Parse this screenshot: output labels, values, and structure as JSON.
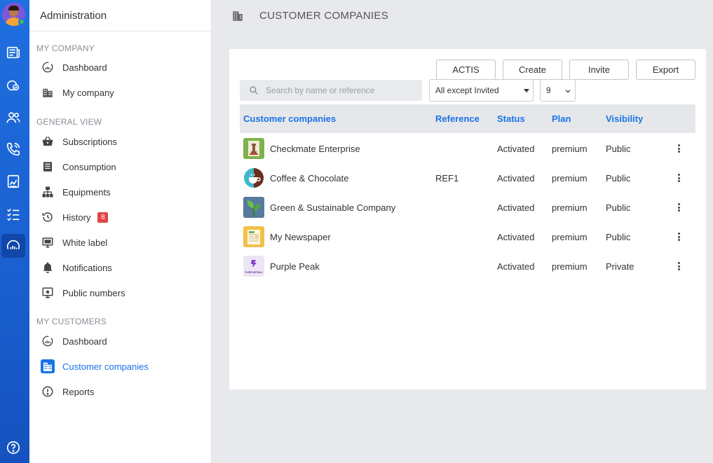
{
  "sidebar": {
    "header": "Administration",
    "sections": [
      {
        "label": "MY COMPANY",
        "items": [
          {
            "label": "Dashboard",
            "icon": "dashboard-icon"
          },
          {
            "label": "My company",
            "icon": "building-icon"
          }
        ]
      },
      {
        "label": "GENERAL VIEW",
        "items": [
          {
            "label": "Subscriptions",
            "icon": "basket-icon"
          },
          {
            "label": "Consumption",
            "icon": "list-icon"
          },
          {
            "label": "Equipments",
            "icon": "hierarchy-icon"
          },
          {
            "label": "History",
            "icon": "history-icon",
            "badge": "8"
          },
          {
            "label": "White label",
            "icon": "monitor-icon"
          },
          {
            "label": "Notifications",
            "icon": "bell-icon"
          },
          {
            "label": "Public numbers",
            "icon": "public-numbers-icon"
          }
        ]
      },
      {
        "label": "MY CUSTOMERS",
        "items": [
          {
            "label": "Dashboard",
            "icon": "dashboard-icon"
          },
          {
            "label": "Customer companies",
            "icon": "building-icon",
            "active": true
          },
          {
            "label": "Reports",
            "icon": "alert-icon"
          }
        ]
      }
    ]
  },
  "header": {
    "title": "CUSTOMER COMPANIES"
  },
  "toolbar": {
    "actis": "ACTIS",
    "create": "Create",
    "invite": "Invite",
    "export": "Export"
  },
  "search": {
    "placeholder": "Search by name or reference",
    "value": ""
  },
  "filters": {
    "status_filter": "All except Invited",
    "page_size": "9"
  },
  "table": {
    "columns": [
      "Customer companies",
      "Reference",
      "Status",
      "Plan",
      "Visibility"
    ],
    "rows": [
      {
        "name": "Checkmate Enterprise",
        "reference": "",
        "status": "Activated",
        "plan": "premium",
        "visibility": "Public",
        "logo": "chess-logo"
      },
      {
        "name": "Coffee & Chocolate",
        "reference": "REF1",
        "status": "Activated",
        "plan": "premium",
        "visibility": "Public",
        "logo": "coffee-logo"
      },
      {
        "name": "Green & Sustainable Company",
        "reference": "",
        "status": "Activated",
        "plan": "premium",
        "visibility": "Public",
        "logo": "leaf-logo"
      },
      {
        "name": "My Newspaper",
        "reference": "",
        "status": "Activated",
        "plan": "premium",
        "visibility": "Public",
        "logo": "newspaper-logo"
      },
      {
        "name": "Purple Peak",
        "reference": "",
        "status": "Activated",
        "plan": "premium",
        "visibility": "Private",
        "logo": "purple-peak-logo",
        "logo_text": "PURPLEPEAK"
      }
    ]
  },
  "colors": {
    "rail": "#1f6fe0",
    "accent": "#1a73e8",
    "badge": "#e04545"
  }
}
